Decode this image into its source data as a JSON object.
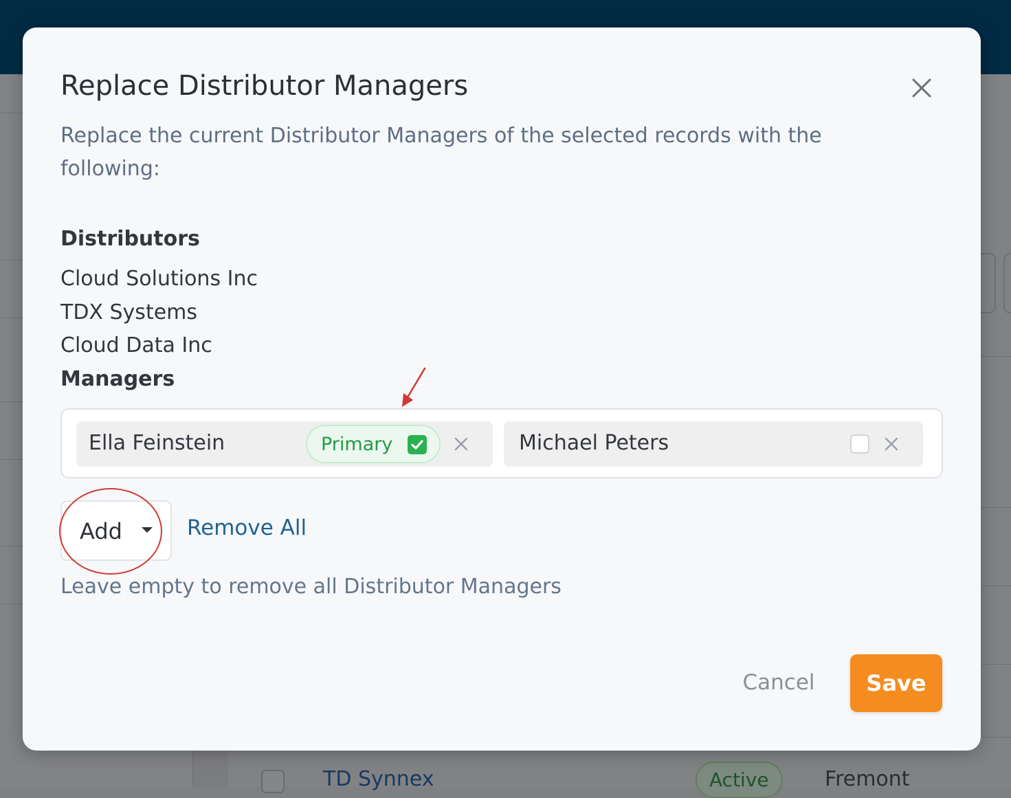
{
  "dialog": {
    "title": "Replace Distributor Managers",
    "description": "Replace the current Distributor Managers of the selected records with the following:",
    "distributors_label": "Distributors",
    "distributors": [
      "Cloud Solutions Inc",
      "TDX Systems",
      "Cloud Data Inc"
    ],
    "managers_label": "Managers",
    "managers": [
      {
        "name": "Ella Feinstein",
        "primary_label": "Primary",
        "is_primary": true
      },
      {
        "name": "Michael Peters",
        "is_primary": false
      }
    ],
    "add_label": "Add",
    "remove_all_label": "Remove All",
    "hint": "Leave empty to remove all Distributor Managers",
    "cancel_label": "Cancel",
    "save_label": "Save"
  },
  "background": {
    "row": {
      "name": "TD Synnex",
      "status": "Active",
      "city": "Fremont"
    }
  },
  "colors": {
    "header": "#022a45",
    "accent": "#f48c1f",
    "link": "#1f6294",
    "primary_green": "#2bb14f",
    "annotation": "#cf3a32"
  },
  "icons": [
    "close-icon",
    "check-icon",
    "remove-icon",
    "caret-down-icon",
    "annotation-arrow-icon"
  ]
}
